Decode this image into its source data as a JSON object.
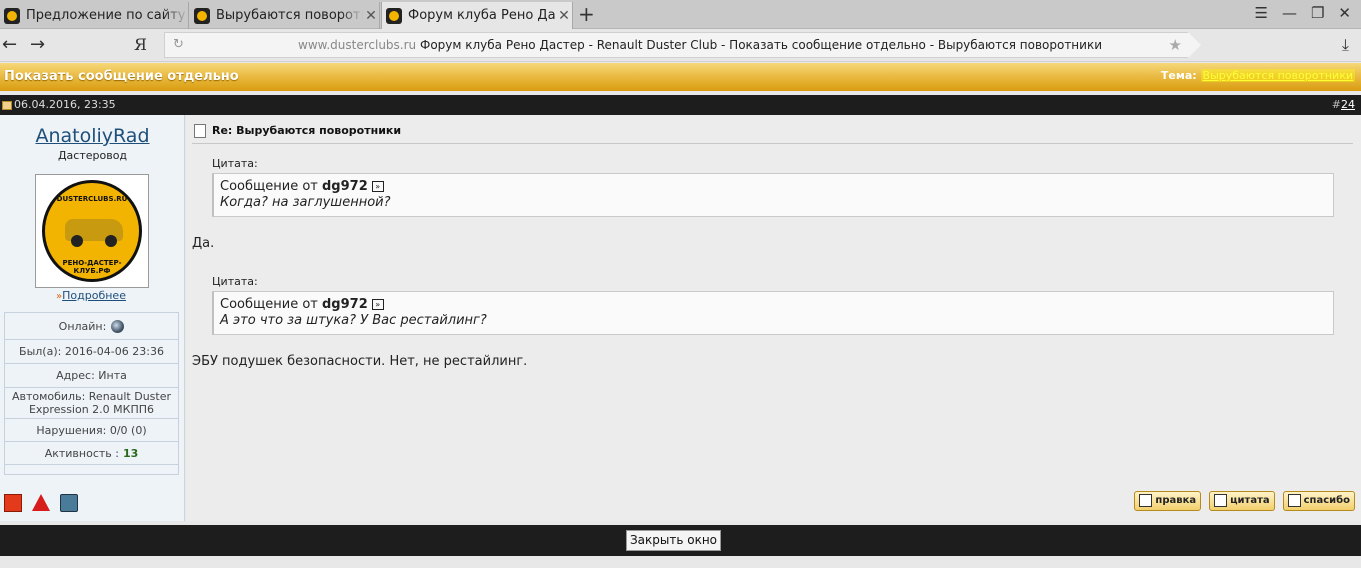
{
  "browser": {
    "tabs": [
      {
        "label": "Предложение по сайту! - Ох"
      },
      {
        "label": "Вырубаются поворотники"
      },
      {
        "label": "Форум клуба Рено Дастер",
        "close": "✕"
      }
    ],
    "tab_close": "✕",
    "new_tab": "+",
    "window_buttons": {
      "menu": "☰",
      "minimize": "—",
      "restore": "❐",
      "close": "✕"
    },
    "back": "←",
    "forward": "→",
    "search_logo": "Я",
    "address": {
      "domain": "www.dusterclubs.ru",
      "page_title": "Форум клуба Рено Дастер - Renault Duster Club - Показать сообщение отдельно - Вырубаются поворотники"
    },
    "reload_icon": "↻",
    "bookmark_icon": "★",
    "download_icon": "⤓"
  },
  "page": {
    "header": {
      "title": "Показать сообщение отдельно",
      "theme_label": "Тема:",
      "theme_link": "Вырубаются поворотники"
    },
    "post_bar": {
      "date": "06.04.2016, 23:35",
      "number_prefix": "#",
      "number": "24"
    },
    "user": {
      "name": "AnatoliyRad",
      "rank": "Дастеровод",
      "avatar_text_top": "DUSTERCLUBS.RU",
      "avatar_text_bottom": "РЕНО-ДАСТЕР-КЛУБ.РФ",
      "more_arrow": "»",
      "more_label": "Подробнее",
      "info": {
        "online_label": "Онлайн:",
        "last_seen": "Был(а): 2016-04-06 23:36",
        "address": "Адрес: Инта",
        "car_line1": "Автомобиль: Renault Duster",
        "car_line2": "Expression 2.0 МКПП6",
        "violations": "Нарушения: 0/0 (0)",
        "activity_label": "Активность :",
        "activity_value": "13"
      }
    },
    "post": {
      "title": "Re: Вырубаются поворотники",
      "quote_label": "Цитата:",
      "quotes": [
        {
          "from_prefix": "Сообщение от",
          "author": "dg972",
          "go_icon": "»",
          "text": "Когда? на заглушенной?"
        },
        {
          "from_prefix": "Сообщение от",
          "author": "dg972",
          "go_icon": "»",
          "text": "А это что за штука? У Вас рестайлинг?"
        }
      ],
      "replies": [
        "Да.",
        "ЭБУ подушек безопасности. Нет, не рестайлинг."
      ],
      "actions": {
        "edit": "правка",
        "quote": "цитата",
        "thanks": "спасибо"
      }
    },
    "footer": {
      "close_button": "Закрыть окно"
    }
  },
  "colors": {
    "header_gold": "#e7b63a",
    "dark_bar": "#1d1d1d",
    "link_blue": "#1e4f7a",
    "activity_green": "#2a6a1a"
  }
}
